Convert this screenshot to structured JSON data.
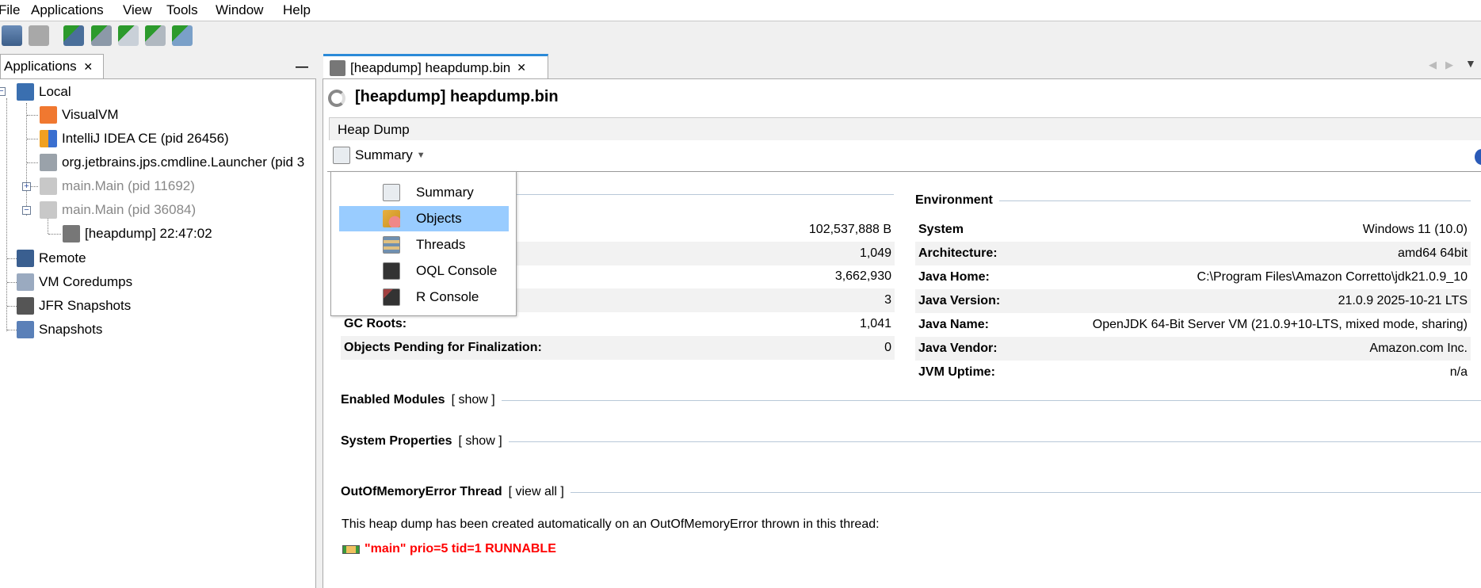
{
  "menu": [
    "File",
    "Applications",
    "View",
    "Tools",
    "Window",
    "Help"
  ],
  "toolbar": {
    "icons": [
      "load-icon",
      "save-icon",
      "add-host-icon",
      "add-jmx-icon",
      "add-coredump-icon",
      "add-jfr-icon",
      "add-snapshot-icon"
    ]
  },
  "left": {
    "tab": "Applications",
    "close": "✕",
    "minimize": "—",
    "tree": [
      "Local",
      "VisualVM",
      "IntelliJ IDEA CE (pid 26456)",
      "org.jetbrains.jps.cmdline.Launcher (pid 3",
      "main.Main (pid 11692)",
      "main.Main (pid 36084)",
      "[heapdump] 22:47:02",
      "Remote",
      "VM Coredumps",
      "JFR Snapshots",
      "Snapshots"
    ]
  },
  "right": {
    "tab": "[heapdump] heapdump.bin",
    "close": "✕",
    "title": "[heapdump] heapdump.bin",
    "subheader": "Heap Dump",
    "view_selector": "Summary",
    "menu": [
      "Summary",
      "Objects",
      "Threads",
      "OQL Console",
      "R Console"
    ],
    "basic_values": [
      "102,537,888 B",
      "1,049",
      "3,662,930",
      "3"
    ],
    "gc_roots_label": "GC Roots:",
    "gc_roots": "1,041",
    "pending_label": "Objects Pending for Finalization:",
    "pending": "0",
    "env_title": "Environment",
    "env": [
      [
        "System",
        "Windows 11 (10.0)"
      ],
      [
        "Architecture:",
        "amd64 64bit"
      ],
      [
        "Java Home:",
        "C:\\Program Files\\Amazon Corretto\\jdk21.0.9_10"
      ],
      [
        "Java Version:",
        "21.0.9 2025-10-21 LTS"
      ],
      [
        "Java Name:",
        "OpenJDK 64-Bit Server VM (21.0.9+10-LTS, mixed mode, sharing)"
      ],
      [
        "Java Vendor:",
        "Amazon.com Inc."
      ],
      [
        "JVM Uptime:",
        "n/a"
      ]
    ],
    "modules": "Enabled Modules",
    "modules_link": "[ show ]",
    "props": "System Properties",
    "props_link": "[ show ]",
    "oom": "OutOfMemoryError Thread",
    "oom_link": "[ view all ]",
    "oom_text": "This heap dump has been created automatically on an OutOfMemoryError thrown in this thread:",
    "thread": "\"main\" prio=5 tid=1 RUNNABLE"
  },
  "colors": {
    "selection": "#99ccff",
    "thread": "#ff0000",
    "tab_accent": "#2b8ad8"
  }
}
